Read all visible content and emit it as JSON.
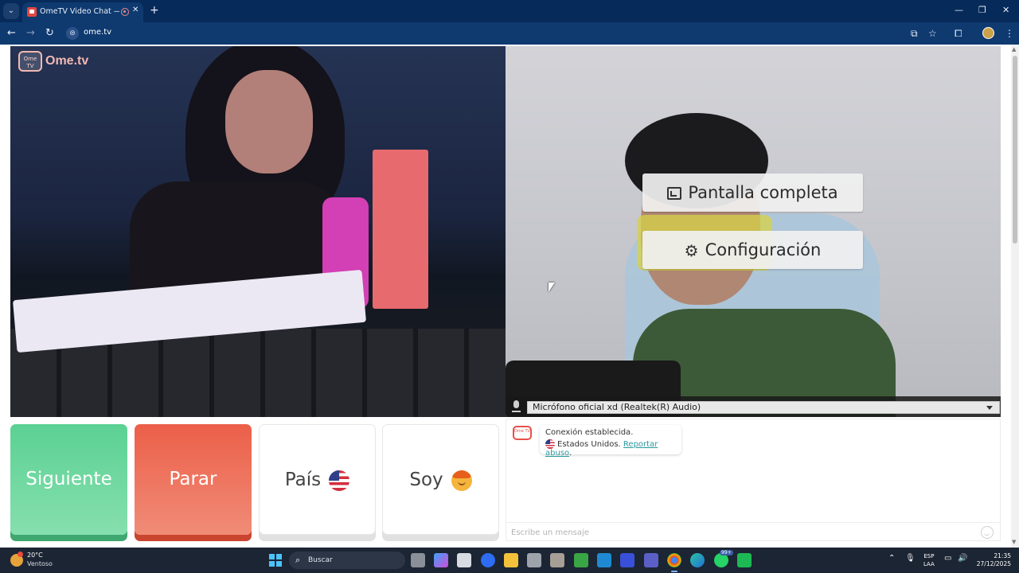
{
  "browser": {
    "tab_title": "OmeTV Video Chat — Omegle",
    "tab_close": "✕",
    "new_tab": "+",
    "address": "ome.tv",
    "window_controls": {
      "minimize": "—",
      "restore": "❐",
      "close": "✕"
    }
  },
  "logo": {
    "icon_text": "Ome TV",
    "text": "Ome.tv"
  },
  "overlay": {
    "fullscreen_label": "Pantalla completa",
    "settings_label": "Configuración"
  },
  "mic": {
    "selected_device": "Micrófono oficial xd (Realtek(R) Audio)"
  },
  "actions": {
    "next_label": "Siguiente",
    "stop_label": "Parar",
    "country_label": "País",
    "gender_label": "Soy"
  },
  "chat": {
    "logo_text": "Ome TV",
    "status_message": "Conexión establecida.",
    "country": "Estados Unidos.",
    "report_link": "Reportar abuso",
    "report_suffix": ".",
    "input_placeholder": "Escribe un mensaje"
  },
  "taskbar": {
    "temperature": "20°C",
    "weather": "Ventoso",
    "search_label": "Buscar",
    "language_line1": "ESP",
    "language_line2": "LAA",
    "time": "21:35",
    "date": "27/12/2025",
    "notification_count": "99+"
  },
  "colors": {
    "next_button": "#5bd193",
    "stop_button": "#ec5f49",
    "browser_chrome": "#0f3a70",
    "link": "#2a9aa0"
  },
  "icons": [
    "fullscreen-icon",
    "gear-icon",
    "microphone-icon",
    "us-flag-icon",
    "boy-emoji-icon",
    "emoji-icon",
    "search-icon"
  ]
}
